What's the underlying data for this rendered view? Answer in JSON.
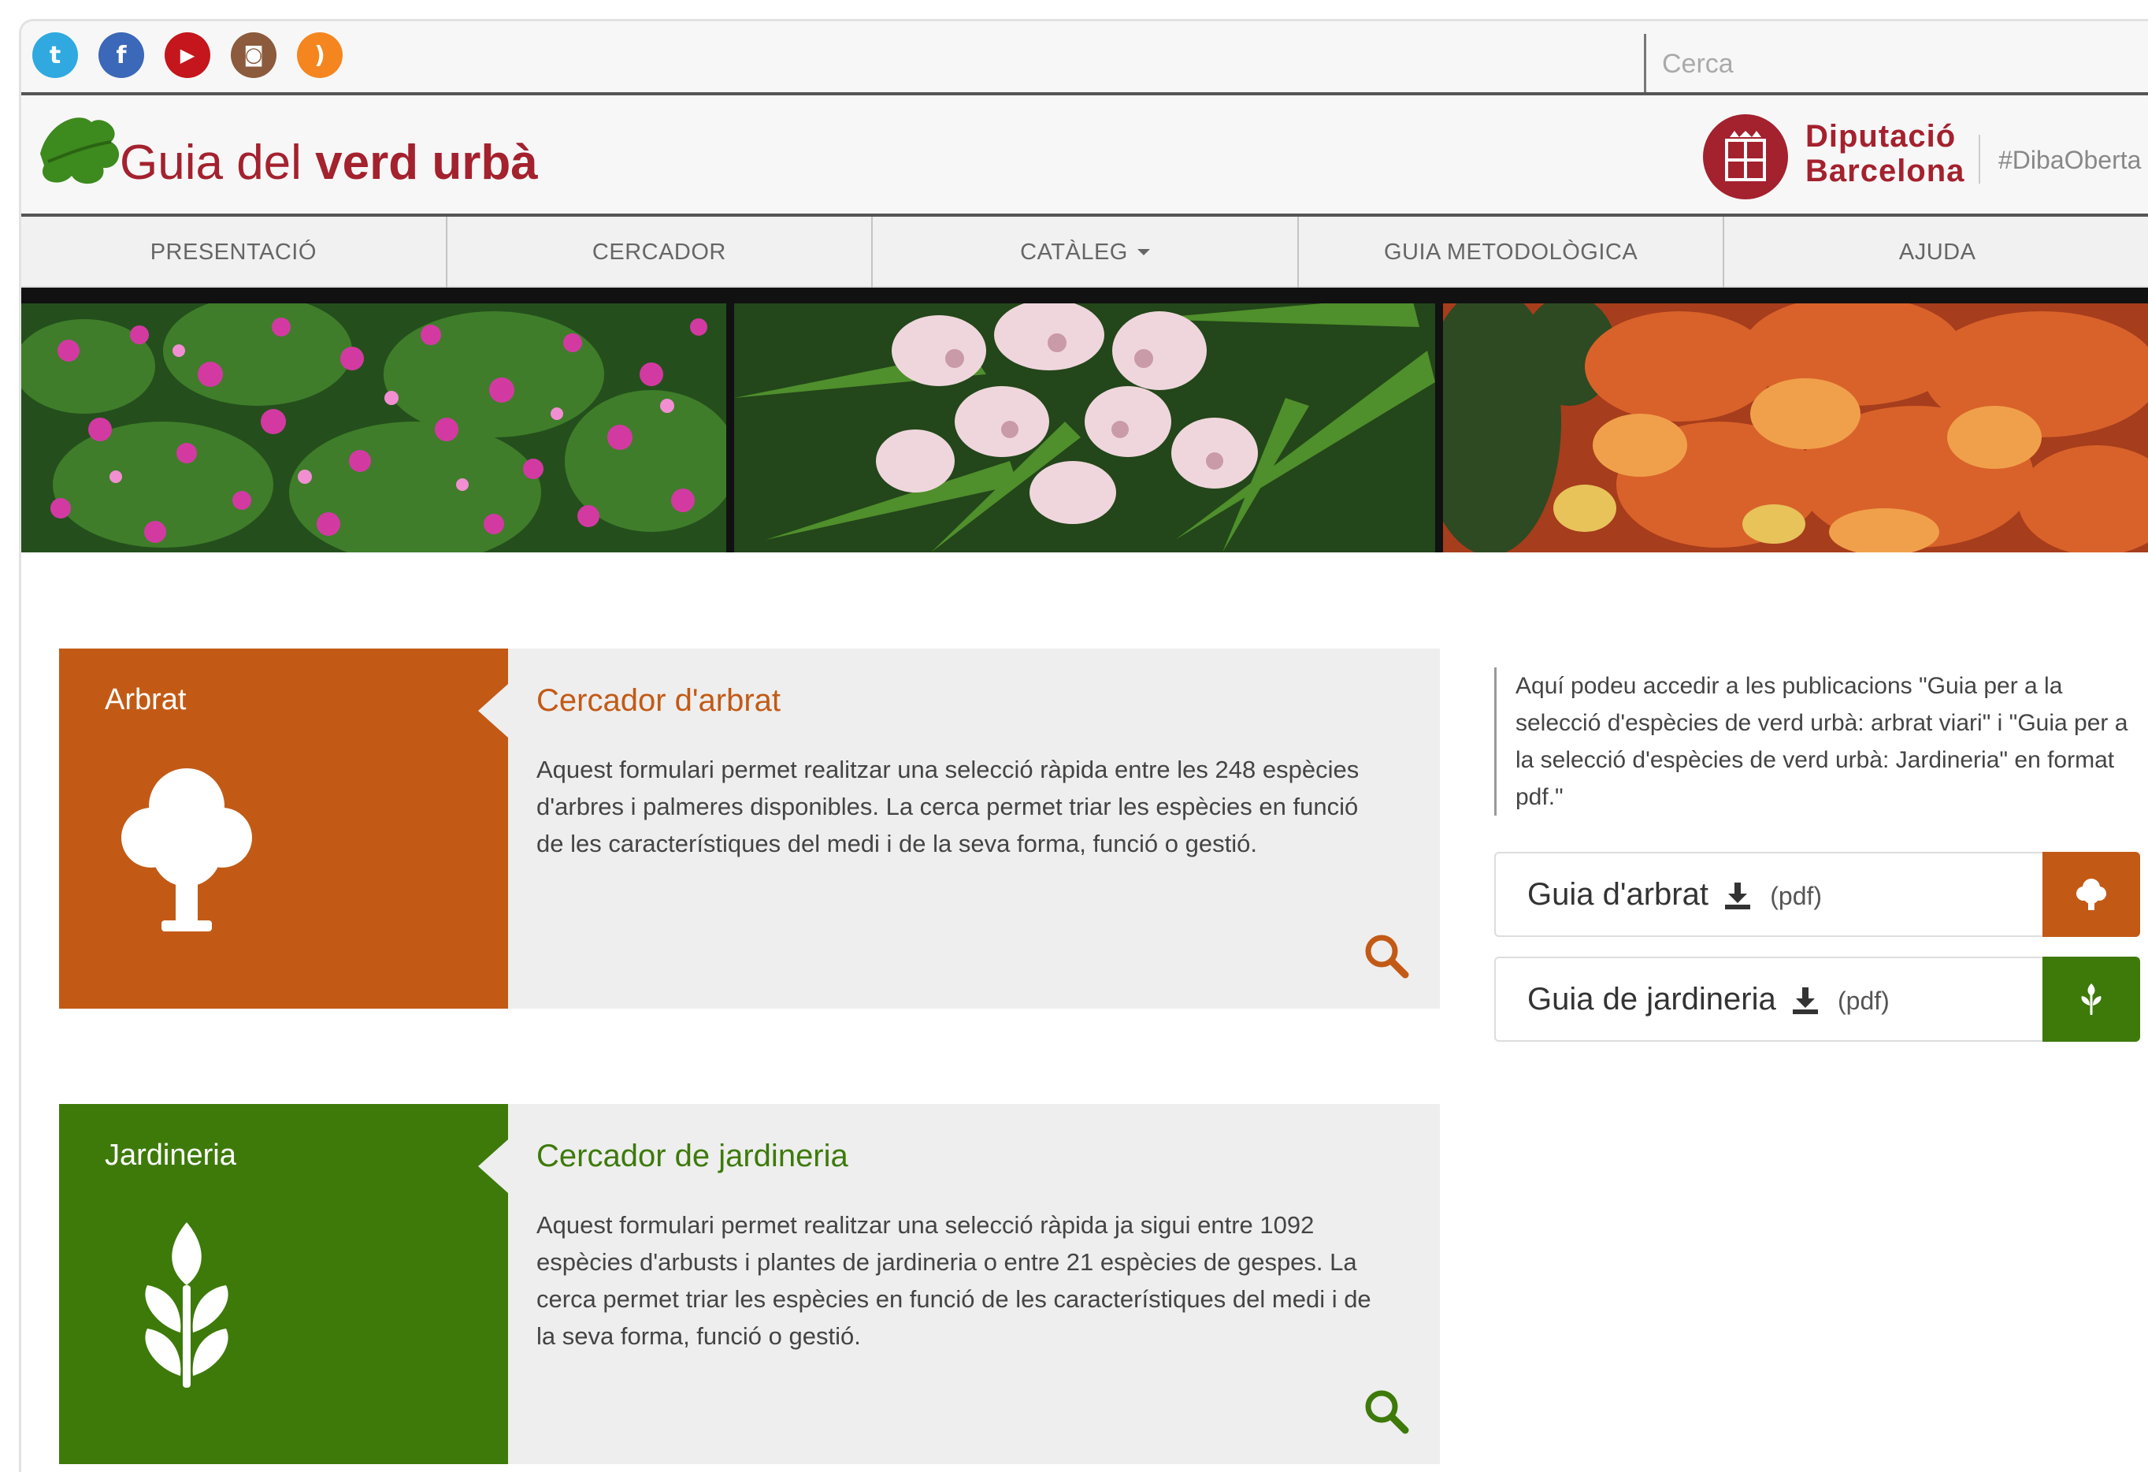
{
  "topbar": {
    "social": [
      {
        "name": "twitter",
        "glyph": "t",
        "color": "#2fa9e0"
      },
      {
        "name": "facebook",
        "glyph": "f",
        "color": "#3b68b8"
      },
      {
        "name": "youtube",
        "glyph": "▶",
        "color": "#c4161c"
      },
      {
        "name": "instagram",
        "glyph": "◙",
        "color": "#8c5a3c"
      },
      {
        "name": "rss",
        "glyph": ")",
        "color": "#f5861f"
      }
    ],
    "search_placeholder": "Cerca"
  },
  "header": {
    "title_plain": "Guia del ",
    "title_bold": "verd urbà",
    "brand_line1": "Diputació",
    "brand_line2": "Barcelona",
    "hashtag": "#DibaOberta"
  },
  "nav": {
    "items": [
      "PRESENTACIÓ",
      "CERCADOR",
      "CATÀLEG",
      "GUIA METODOLÒGICA",
      "AJUDA"
    ]
  },
  "cards": [
    {
      "side_title": "Arbrat",
      "title": "Cercador d'arbrat",
      "text": "Aquest formulari permet realitzar una selecció ràpida entre les 248 espècies d'arbres i palmeres disponibles. La cerca permet triar les espècies en funció de les característiques del medi i de la seva forma, funció o gestió."
    },
    {
      "side_title": "Jardineria",
      "title": "Cercador de jardineria",
      "text": "Aquest formulari permet realitzar una selecció ràpida ja sigui entre 1092 espècies d'arbusts i plantes de jardineria o entre 21 espècies de gespes. La cerca permet triar les espècies en funció de les característiques del medi i de la seva forma, funció o gestió."
    }
  ],
  "publications": {
    "intro": "Aquí podeu accedir a les publicacions \"Guia per a la selecció d'espècies de verd urbà: arbrat viari\" i \"Guia per a la selecció d'espècies de verd urbà: Jardineria\" en format pdf.\"",
    "downloads": [
      {
        "label": "Guia d'arbrat",
        "format": "(pdf)"
      },
      {
        "label": "Guia de jardineria",
        "format": "(pdf)"
      }
    ]
  },
  "colors": {
    "brand_red": "#a4212e",
    "arbrat_orange": "#c25a16",
    "jardineria_green": "#3d7a0a"
  }
}
